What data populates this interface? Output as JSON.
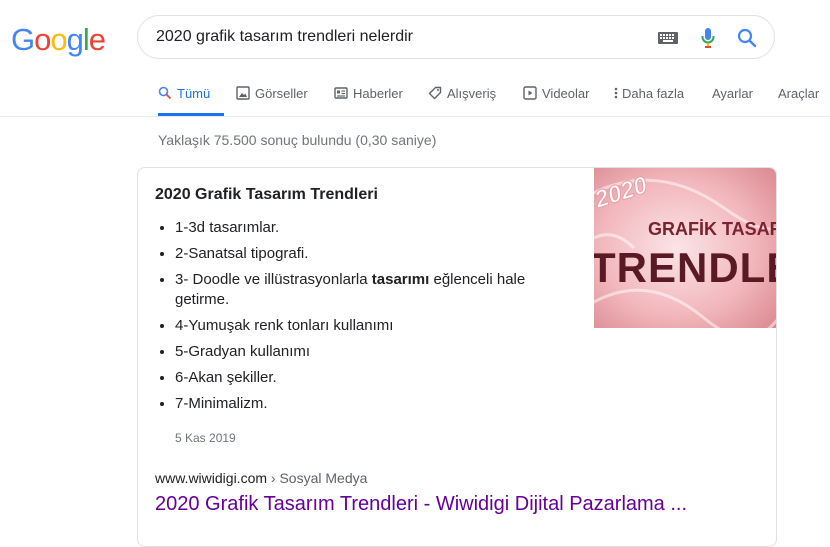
{
  "logo": {
    "letters": [
      "G",
      "o",
      "o",
      "g",
      "l",
      "e"
    ],
    "colors": [
      "#4285F4",
      "#EA4335",
      "#FBBC05",
      "#4285F4",
      "#34A853",
      "#EA4335"
    ]
  },
  "search": {
    "query": "2020 grafik tasarım trendleri nelerdir"
  },
  "icons": {
    "keyboard": "keyboard-icon",
    "mic": "microphone-icon",
    "search": "search-icon"
  },
  "tabs": [
    {
      "label": "Tümü",
      "icon": "search-icon",
      "active": true
    },
    {
      "label": "Görseller",
      "icon": "image-icon"
    },
    {
      "label": "Haberler",
      "icon": "news-icon"
    },
    {
      "label": "Alışveriş",
      "icon": "tag-icon"
    },
    {
      "label": "Videolar",
      "icon": "play-icon"
    },
    {
      "label": "Daha fazla",
      "icon": "more-vert-icon"
    },
    {
      "label": "Ayarlar"
    },
    {
      "label": "Araçlar"
    }
  ],
  "stats": "Yaklaşık 75.500 sonuç bulundu (0,30 saniye)",
  "snippet": {
    "title": "2020 Grafik Tasarım Trendleri",
    "items": [
      {
        "text": "1-3d tasarımlar."
      },
      {
        "text": "2-Sanatsal tipografi."
      },
      {
        "pre": "3- Doodle ve illüstrasyonlarla ",
        "bold": "tasarımı",
        "post": " eğlenceli hale getirme."
      },
      {
        "text": "4-Yumuşak renk tonları kullanımı"
      },
      {
        "text": "5-Gradyan kullanımı"
      },
      {
        "text": "6-Akan şekiller."
      },
      {
        "text": "7-Minimalizm."
      }
    ],
    "date": "5 Kas 2019",
    "cite_domain": "www.wiwidigi.com",
    "cite_path": " › Sosyal Medya",
    "link_text": "2020 Grafik Tasarım Trendleri - Wiwidigi Dijital Pazarlama ...",
    "image": {
      "year": "2020",
      "line1": "GRAFİK TASARIM",
      "line2": "TRENDLER"
    }
  },
  "colors": {
    "accent": "#1a73e8",
    "visited_link": "#660099"
  }
}
